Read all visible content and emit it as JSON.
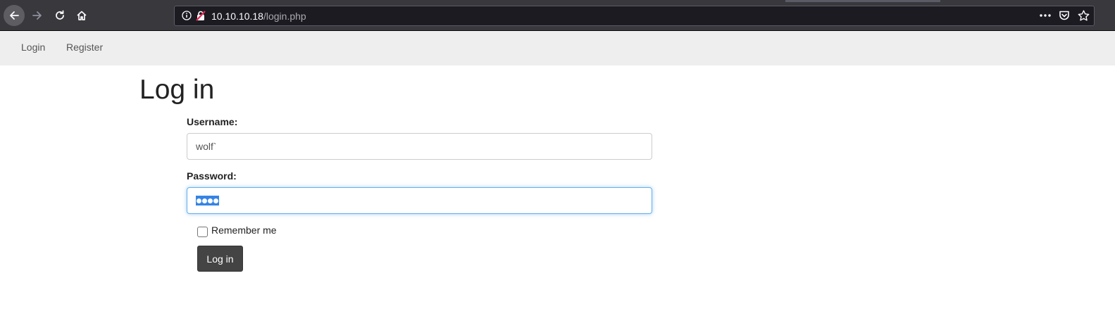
{
  "browser": {
    "url_host": "10.10.10.18",
    "url_path": "/login.php",
    "icons": [
      "back-arrow-icon",
      "forward-arrow-icon",
      "reload-icon",
      "home-icon",
      "info-icon",
      "insecure-lock-icon",
      "more-actions-icon",
      "pocket-icon",
      "bookmark-star-icon"
    ]
  },
  "navbar": {
    "links": [
      {
        "label": "Login"
      },
      {
        "label": "Register"
      }
    ]
  },
  "form": {
    "title": "Log in",
    "username_label": "Username:",
    "username_value": "wolf`",
    "password_label": "Password:",
    "password_masked_chars": 4,
    "remember_label": "Remember me",
    "remember_checked": false,
    "submit_label": "Log in"
  },
  "colors": {
    "chrome_bg": "#38383d",
    "urlbar_bg": "#1c1b22",
    "navbar_bg": "#eeeeee",
    "button_bg": "#444444",
    "focus_border": "#66afe9",
    "selection": "#3584e4"
  }
}
